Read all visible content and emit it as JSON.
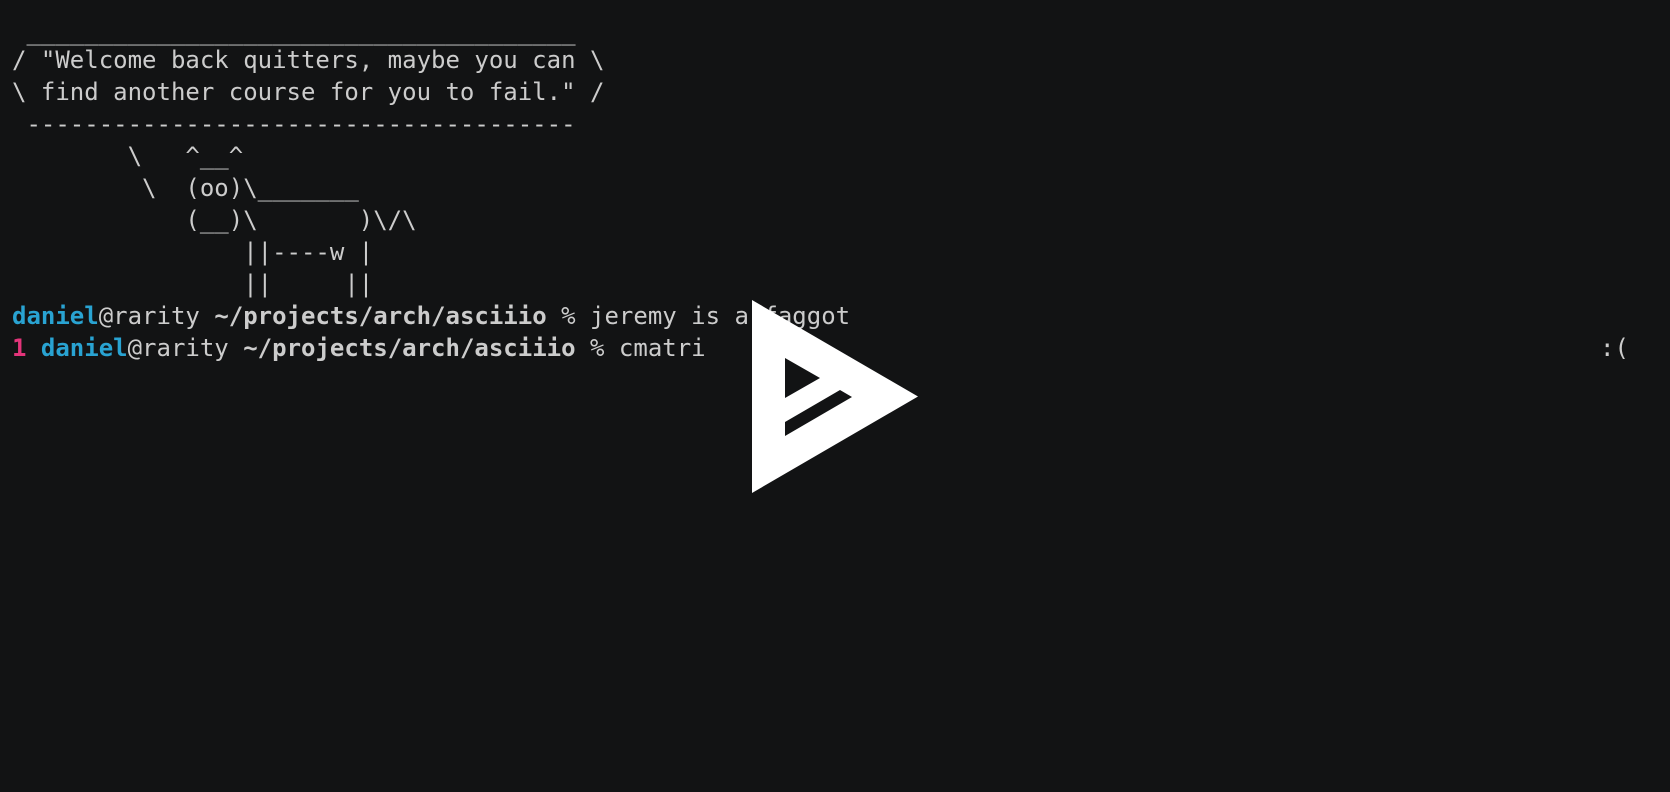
{
  "terminal": {
    "bubble": {
      "top_border": " ______________________________________",
      "line1": "/ \"Welcome back quitters, maybe you can \\",
      "line2": "\\ find another course for you to fail.\" /",
      "bottom_border": " --------------------------------------"
    },
    "cow": [
      "        \\   ^__^",
      "         \\  (oo)\\_______",
      "            (__)\\       )\\/\\",
      "                ||----w |",
      "                ||     ||"
    ],
    "prompt1": {
      "user": "daniel",
      "host": "@rarity",
      "path": "~/projects/arch/asciiio",
      "symbol": "%",
      "command": "jeremy is a faggot"
    },
    "prompt2": {
      "exit_status": "1",
      "user": "daniel",
      "host": "@rarity",
      "path": "~/projects/arch/asciiio",
      "symbol": "%",
      "command": "cmatri",
      "right_prompt": ":("
    }
  },
  "player": {
    "play_icon": "asciinema-play-icon",
    "icon_color": "#ffffff",
    "background_color": "#121314"
  }
}
